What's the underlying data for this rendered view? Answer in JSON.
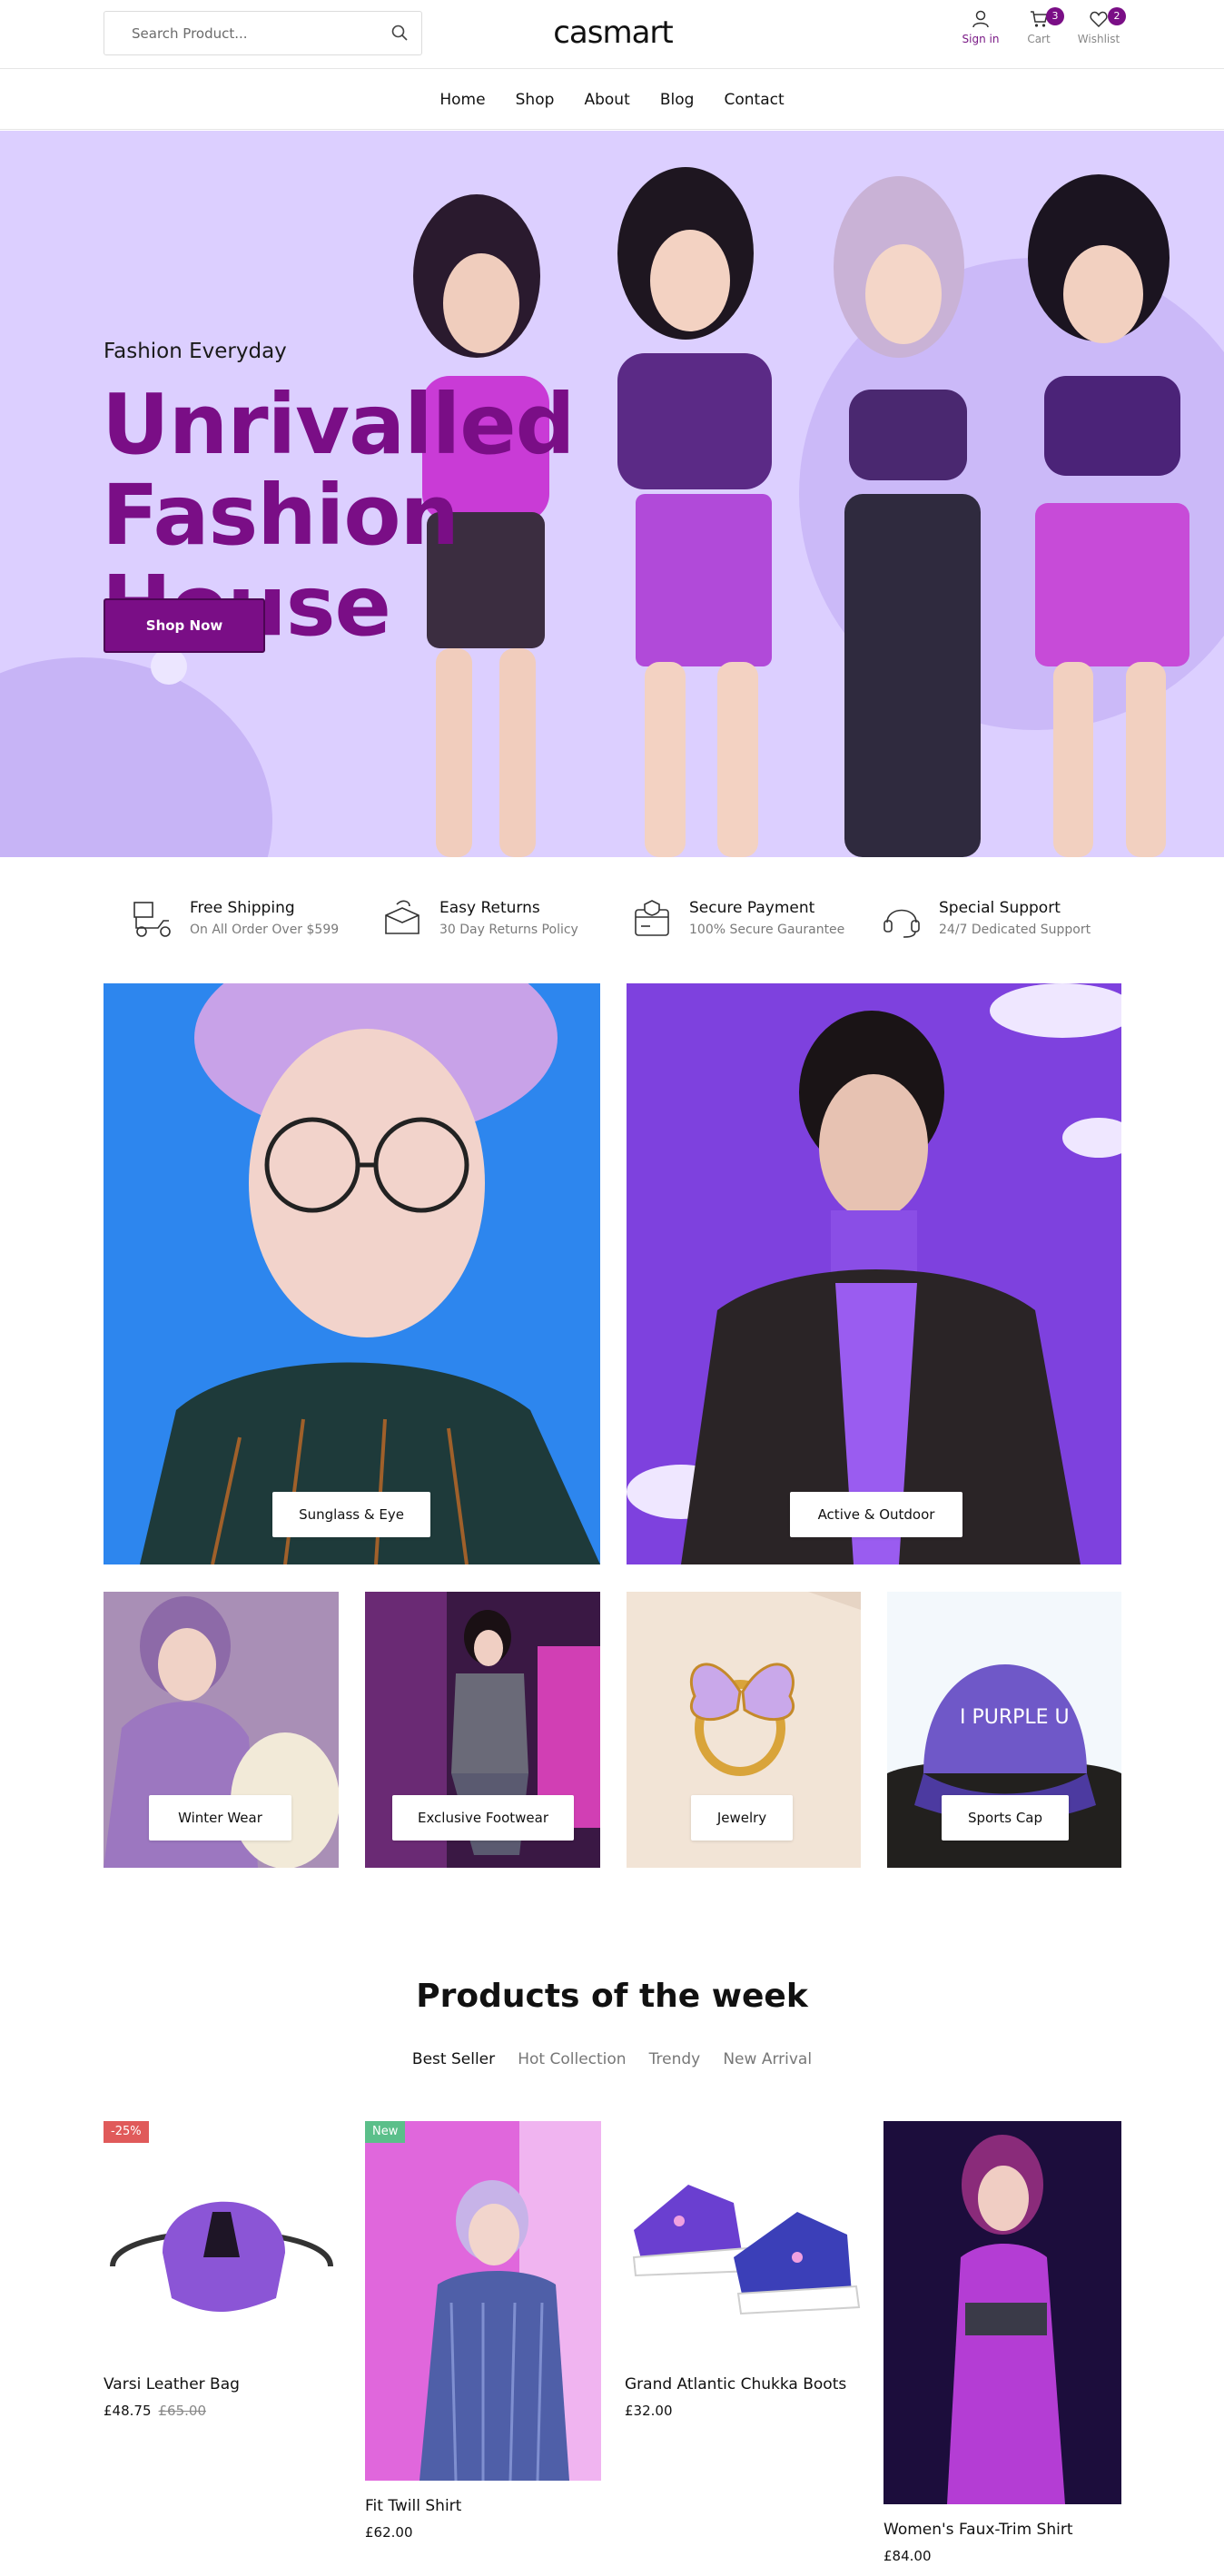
{
  "header": {
    "search_placeholder": "Search Product...",
    "logo": "casmart",
    "signin_label": "Sign in",
    "cart_label": "Cart",
    "cart_count": "3",
    "wishlist_label": "Wishlist",
    "wishlist_count": "2"
  },
  "nav": [
    "Home",
    "Shop",
    "About",
    "Blog",
    "Contact"
  ],
  "hero": {
    "kicker": "Fashion Everyday",
    "headline_line1": "Unrivalled",
    "headline_line2": "Fashion House",
    "button": "Shop Now"
  },
  "features": [
    {
      "icon": "delivery-scooter-icon",
      "title": "Free Shipping",
      "subtitle": "On All Order Over $599"
    },
    {
      "icon": "return-box-icon",
      "title": "Easy Returns",
      "subtitle": "30 Day Returns Policy"
    },
    {
      "icon": "secure-payment-icon",
      "title": "Secure Payment",
      "subtitle": "100% Secure Gaurantee"
    },
    {
      "icon": "headset-support-icon",
      "title": "Special Support",
      "subtitle": "24/7 Dedicated Support"
    }
  ],
  "categories": [
    {
      "label": "Sunglass & Eye"
    },
    {
      "label": "Active & Outdoor"
    },
    {
      "label": "Winter Wear"
    },
    {
      "label": "Exclusive Footwear"
    },
    {
      "label": "Jewelry"
    },
    {
      "label": "Sports Cap"
    }
  ],
  "cap_text": "I PURPLE U",
  "products_section": {
    "title": "Products of the week",
    "tabs": [
      "Best Seller",
      "Hot Collection",
      "Trendy",
      "New Arrival"
    ],
    "active_tab": "Best Seller"
  },
  "products": [
    {
      "name": "Varsi Leather Bag",
      "price": "£48.75",
      "old_price": "£65.00",
      "badge": "-25%",
      "badge_color": "#e05a5a"
    },
    {
      "name": "Fit Twill Shirt",
      "price": "£62.00",
      "badge": "New",
      "badge_color": "#5bbf8a"
    },
    {
      "name": "Grand Atlantic Chukka Boots",
      "price": "£32.00"
    },
    {
      "name": "Women's Faux-Trim Shirt",
      "price": "£84.00"
    }
  ],
  "colors": {
    "brand": "#7a0e86",
    "hero_bg": "#dccfff"
  }
}
